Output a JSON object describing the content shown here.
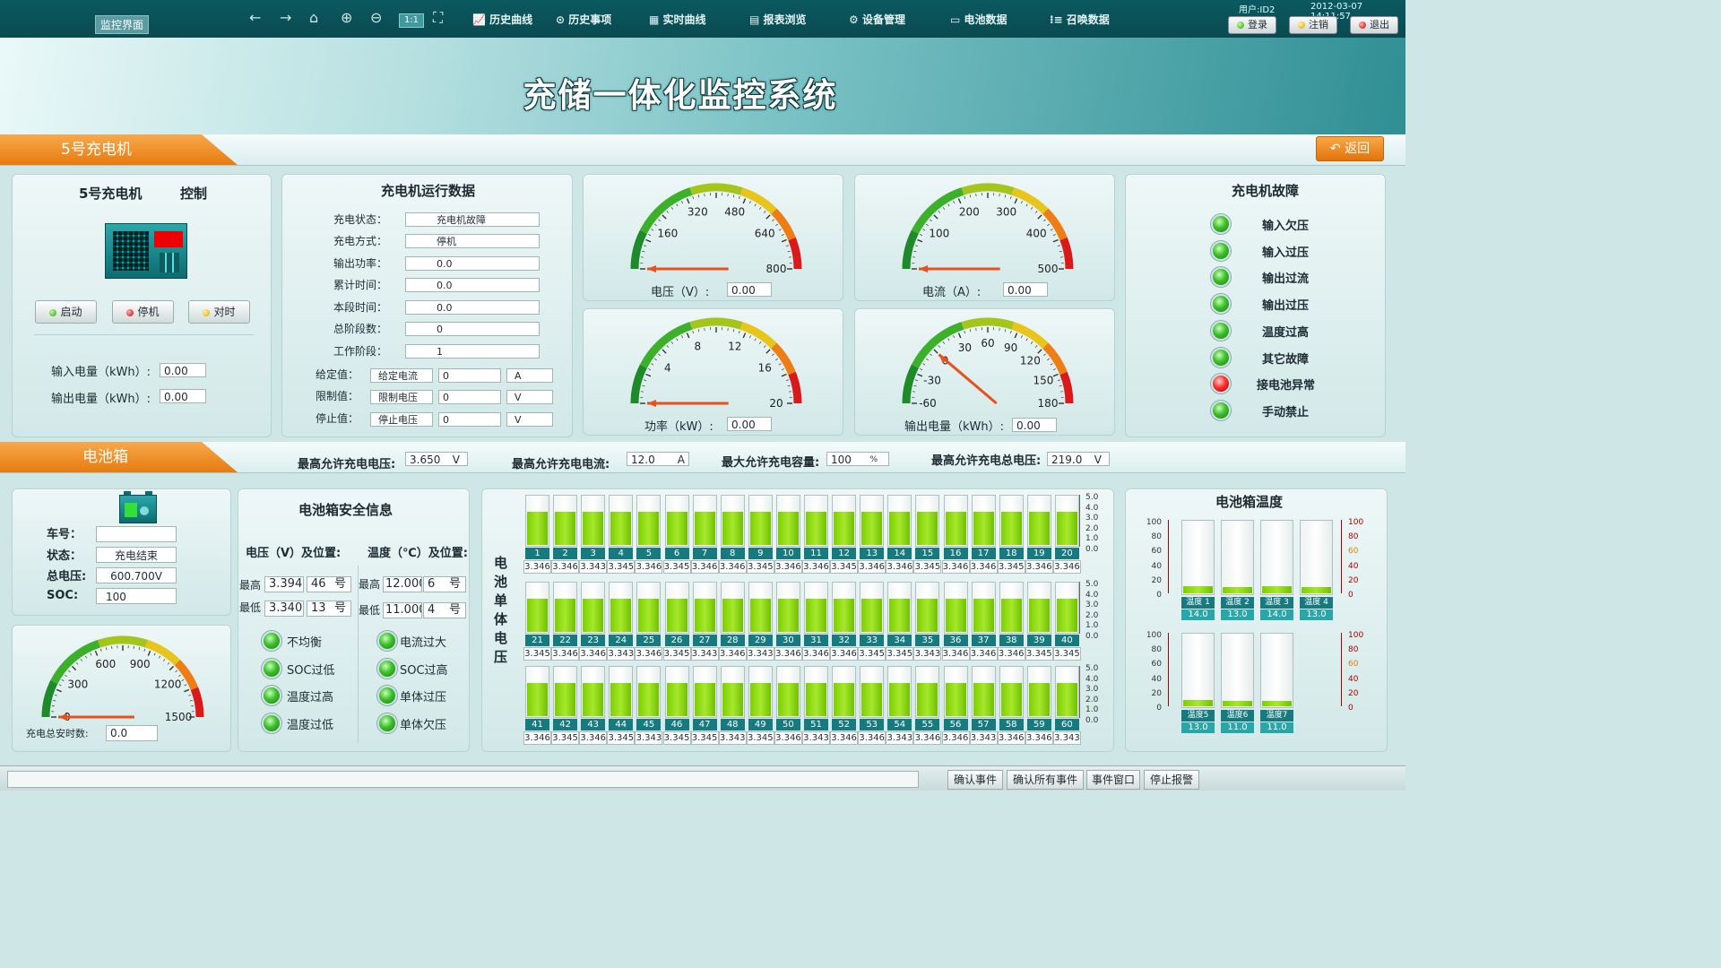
{
  "topbar": {
    "monitor_tab": "监控界面",
    "zoom_reset": "1:1",
    "menu": [
      "历史曲线",
      "历史事项",
      "实时曲线",
      "报表浏览",
      "设备管理",
      "电池数据",
      "召唤数据"
    ],
    "user": "用户:ID2",
    "datetime": "2012-03-07 14:11:57",
    "login": "登录",
    "logout": "注销",
    "exit": "退出"
  },
  "title": "充储一体化监控系统",
  "charger_section": {
    "title": "5号充电机",
    "back": "返回"
  },
  "control_panel": {
    "title": "5号充电机",
    "subtitle": "控制",
    "start": "启动",
    "stop": "停机",
    "sync": "对时",
    "in_energy_label": "输入电量（kWh）:",
    "in_energy": "0.00",
    "out_energy_label": "输出电量（kWh）:",
    "out_energy": "0.00"
  },
  "run_data": {
    "title": "充电机运行数据",
    "rows": [
      {
        "label": "充电状态：",
        "value": "充电机故障"
      },
      {
        "label": "充电方式：",
        "value": "停机"
      },
      {
        "label": "输出功率：",
        "value": "0.0"
      },
      {
        "label": "累计时间：",
        "value": "0.0"
      },
      {
        "label": "本段时间：",
        "value": "0.0"
      },
      {
        "label": "总阶段数：",
        "value": "0"
      },
      {
        "label": "工作阶段：",
        "value": "1"
      }
    ],
    "set_rows": [
      {
        "label": "给定值：",
        "name": "给定电流",
        "value": "0",
        "unit": "A"
      },
      {
        "label": "限制值：",
        "name": "限制电压",
        "value": "0",
        "unit": "V"
      },
      {
        "label": "停止值：",
        "name": "停止电压",
        "value": "0",
        "unit": "V"
      }
    ]
  },
  "gauges": {
    "voltage": {
      "ticks": [
        "160",
        "320",
        "480",
        "640",
        "800"
      ],
      "label": "电压（V）:",
      "value": "0.00",
      "reading": 0,
      "min": 0,
      "max": 800
    },
    "current": {
      "ticks": [
        "100",
        "200",
        "300",
        "400",
        "500"
      ],
      "label": "电流（A）:",
      "value": "0.00",
      "reading": 0,
      "min": 0,
      "max": 500
    },
    "power": {
      "ticks": [
        "4",
        "8",
        "12",
        "16",
        "20"
      ],
      "label": "功率（kW）:",
      "value": "0.00",
      "reading": 0,
      "min": 0,
      "max": 20
    },
    "out_energy": {
      "ticks": [
        "-60",
        "-30",
        "0",
        "30",
        "60",
        "90",
        "120",
        "150",
        "180"
      ],
      "label": "输出电量（kWh）:",
      "value": "0.00",
      "reading": 0,
      "min": -60,
      "max": 180
    },
    "charge_time": {
      "ticks": [
        "0",
        "300",
        "600",
        "900",
        "1200",
        "1500"
      ],
      "label": "充电总安时数:",
      "value": "0.0",
      "reading": 0,
      "min": 0,
      "max": 1500
    }
  },
  "faults": {
    "title": "充电机故障",
    "items": [
      {
        "label": "输入欠压",
        "state": "green"
      },
      {
        "label": "输入过压",
        "state": "green"
      },
      {
        "label": "输出过流",
        "state": "green"
      },
      {
        "label": "输出过压",
        "state": "green"
      },
      {
        "label": "温度过高",
        "state": "green"
      },
      {
        "label": "其它故障",
        "state": "green"
      },
      {
        "label": "接电池异常",
        "state": "red"
      },
      {
        "label": "手动禁止",
        "state": "green"
      }
    ]
  },
  "battery_section": {
    "title": "电池箱",
    "max_cell_voltage_label": "最高允许充电电压:",
    "max_cell_voltage": "3.650",
    "max_cell_voltage_unit": "V",
    "max_current_label": "最高允许充电电流:",
    "max_current": "12.0",
    "max_current_unit": "A",
    "max_capacity_label": "最大允许充电容量:",
    "max_capacity": "100",
    "max_capacity_unit": "%",
    "max_total_voltage_label": "最高允许充电总电压:",
    "max_total_voltage": "219.0",
    "max_total_voltage_unit": "V"
  },
  "battery_info": {
    "car_label": "车号：",
    "car": "",
    "state_label": "状态：",
    "state": "充电结束",
    "total_v_label": "总电压:",
    "total_v": "600.700V",
    "soc_label": "SOC:",
    "soc": "100"
  },
  "safety": {
    "title": "电池箱安全信息",
    "volt_header": "电压（V）及位置:",
    "temp_header": "温度（℃）及位置:",
    "max_label": "最高",
    "min_label": "最低",
    "v_max": "3.394",
    "v_max_pos": "46",
    "v_min": "3.340",
    "v_min_pos": "13",
    "t_max": "12.000",
    "t_max_pos": "6",
    "t_min": "11.000",
    "t_min_pos": "4",
    "pos_unit": "号",
    "alarms_left": [
      "不均衡",
      "SOC过低",
      "温度过高",
      "温度过低"
    ],
    "alarms_right": [
      "电流过大",
      "SOC过高",
      "单体过压",
      "单体欠压"
    ]
  },
  "cells": {
    "title_chars": [
      "电",
      "池",
      "单",
      "体",
      "电",
      "压"
    ],
    "scale": [
      "5.0",
      "4.0",
      "3.0",
      "2.0",
      "1.0",
      "0.0"
    ],
    "voltages": [
      "3.346",
      "3.346",
      "3.343",
      "3.345",
      "3.346",
      "3.345",
      "3.346",
      "3.346",
      "3.345",
      "3.346",
      "3.346",
      "3.345",
      "3.346",
      "3.346",
      "3.345",
      "3.346",
      "3.346",
      "3.345",
      "3.346",
      "3.346",
      "3.345",
      "3.346",
      "3.346",
      "3.343",
      "3.346",
      "3.345",
      "3.343",
      "3.346",
      "3.343",
      "3.346",
      "3.346",
      "3.346",
      "3.345",
      "3.345",
      "3.343",
      "3.346",
      "3.346",
      "3.346",
      "3.345",
      "3.345",
      "3.346",
      "3.345",
      "3.346",
      "3.345",
      "3.343",
      "3.345",
      "3.345",
      "3.343",
      "3.345",
      "3.346",
      "3.343",
      "3.346",
      "3.346",
      "3.343",
      "3.346",
      "3.346",
      "3.343",
      "3.346",
      "3.346",
      "3.343"
    ]
  },
  "temps": {
    "title": "电池箱温度",
    "scale": [
      "100",
      "80",
      "60",
      "40",
      "20",
      "0"
    ],
    "sensors": [
      {
        "label": "温度 1",
        "value": "14.0"
      },
      {
        "label": "温度 2",
        "value": "13.0"
      },
      {
        "label": "温度 3",
        "value": "14.0"
      },
      {
        "label": "温度 4",
        "value": "13.0"
      },
      {
        "label": "温度5",
        "value": "13.0"
      },
      {
        "label": "温度6",
        "value": "11.0"
      },
      {
        "label": "温度7",
        "value": "11.0"
      }
    ]
  },
  "bottom": {
    "confirm": "确认事件",
    "confirm_all": "确认所有事件",
    "event_window": "事件窗口",
    "stop_alarm": "停止报警"
  },
  "colors": {
    "accent": "#e77b10",
    "teal": "#0a4a50",
    "led_green": "#3cc02a",
    "led_red": "#ff3030",
    "cell_fill": "#8ed81a"
  }
}
